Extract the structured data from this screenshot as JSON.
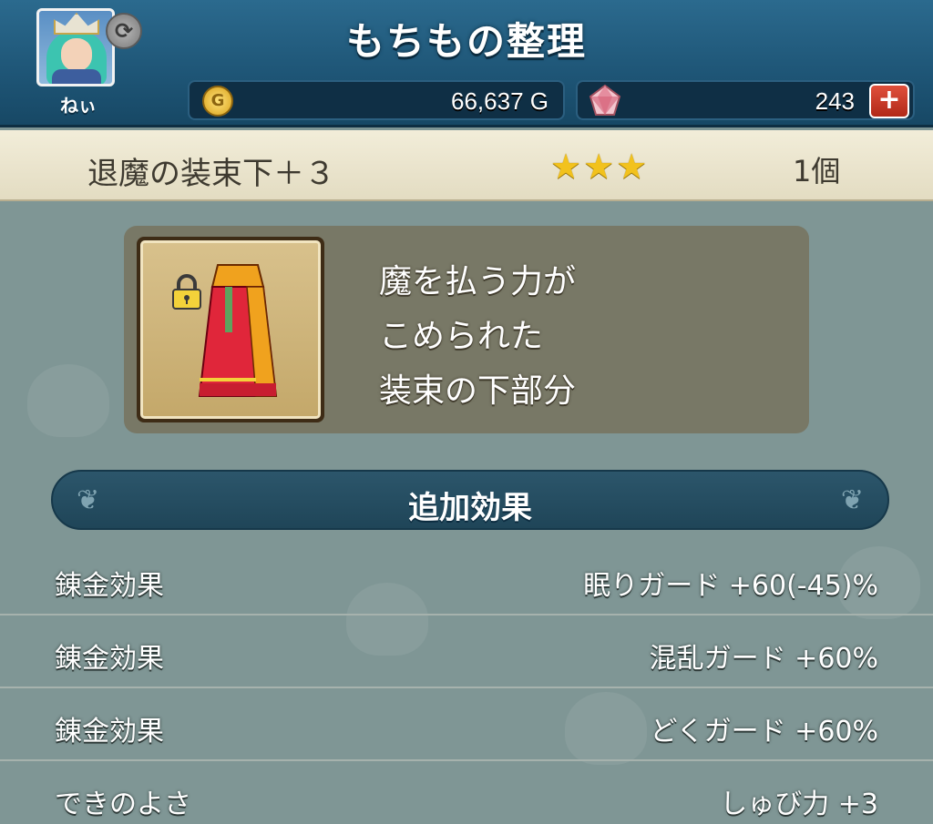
{
  "header": {
    "title": "もちもの整理",
    "avatar_name": "ねぃ",
    "gold": "66,637 G",
    "gems": "243",
    "refresh_icon": "refresh-icon",
    "plus_label": "+"
  },
  "item": {
    "name": "退魔の装束下＋３",
    "rarity_stars": 3,
    "stars_text": "★★★",
    "count": "1個",
    "locked": true,
    "description_lines": [
      "魔を払う力が",
      "こめられた",
      "装束の下部分"
    ]
  },
  "section": {
    "title": "追加効果"
  },
  "effects": [
    {
      "label": "錬金効果",
      "value": "眠りガード +60(-45)%"
    },
    {
      "label": "錬金効果",
      "value": "混乱ガード +60%"
    },
    {
      "label": "錬金効果",
      "value": "どくガード +60%"
    },
    {
      "label": "できのよさ",
      "value": "しゅび力 +3"
    }
  ],
  "colors": {
    "header_bg": "#1e5576",
    "item_row_bg": "#f2edd9",
    "star": "#f2c21d",
    "skirt_red": "#e0263a",
    "skirt_gold": "#f0a21e"
  }
}
